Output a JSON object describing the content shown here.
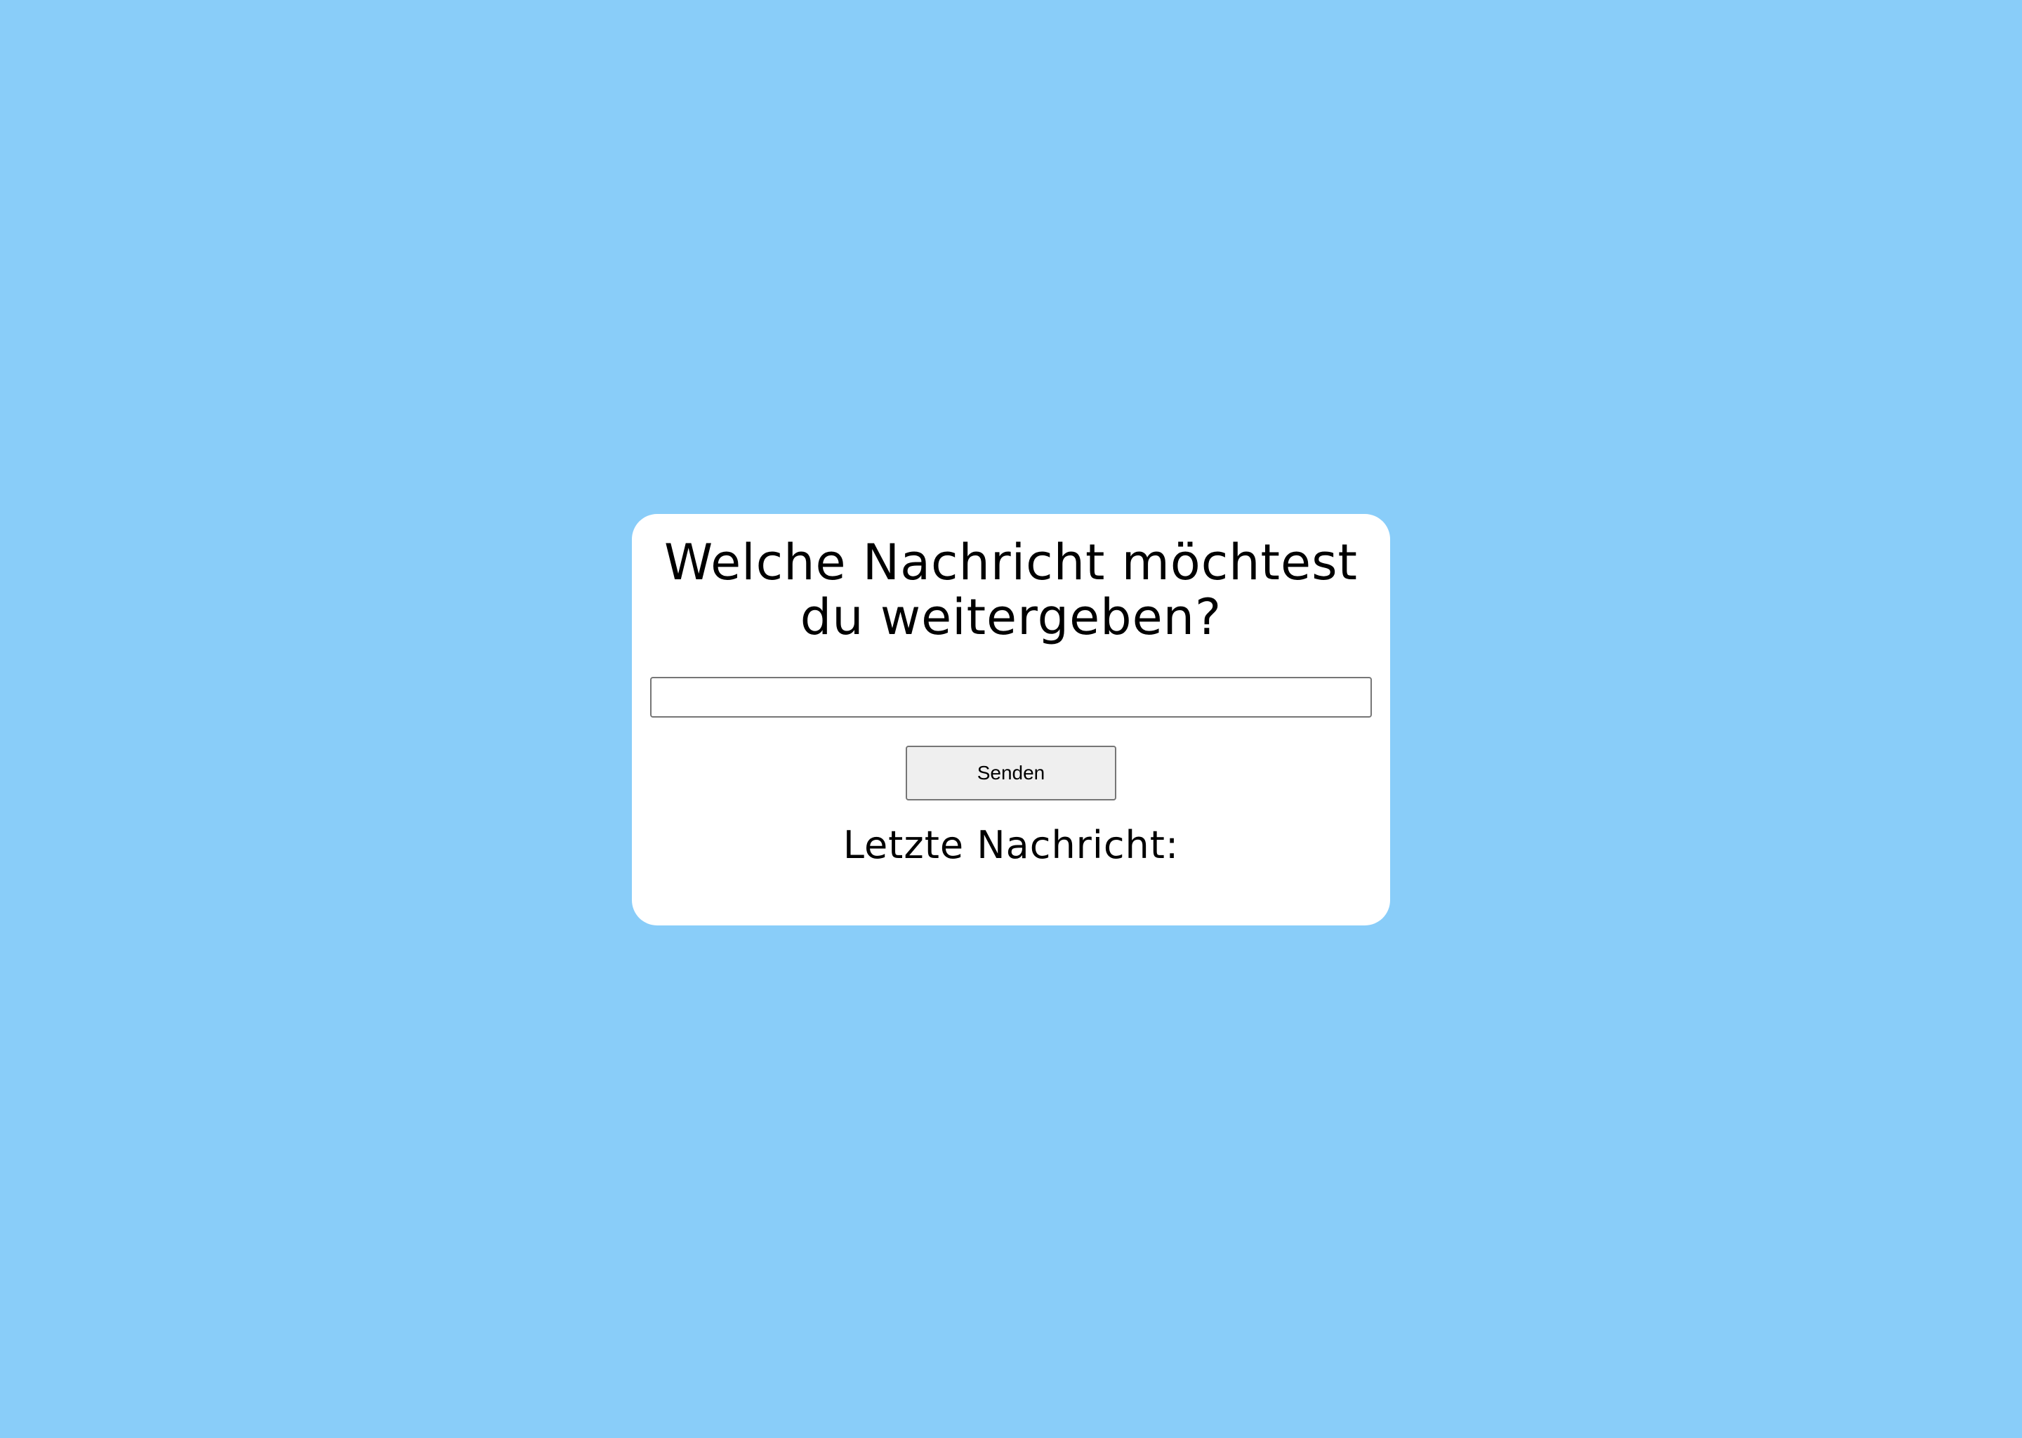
{
  "colors": {
    "background": "#89cdf9",
    "card": "#ffffff",
    "button": "#efefef"
  },
  "card": {
    "title_line_1": "Welche Nachricht möchtest",
    "title_line_2": "du weitergeben?",
    "input_value": "",
    "send_label": "Senden",
    "last_message_label": "Letzte Nachricht:"
  }
}
